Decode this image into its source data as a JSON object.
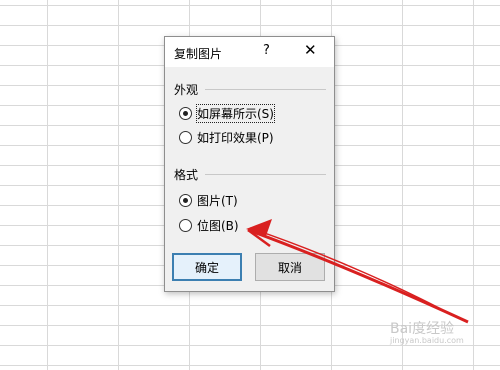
{
  "dialog": {
    "title": "复制图片",
    "help": "?",
    "close": "✕",
    "appearance": {
      "label": "外观",
      "options": [
        "如屏幕所示(S)",
        "如打印效果(P)"
      ],
      "selected": 0
    },
    "format": {
      "label": "格式",
      "options": [
        "图片(T)",
        "位图(B)"
      ],
      "selected": 0
    },
    "ok_label": "确定",
    "cancel_label": "取消"
  },
  "watermark": {
    "text": "Bai度经验",
    "sub": "jingyan.baidu.com"
  },
  "colors": {
    "arrow": "#d92020",
    "grid": "#d9d9d9"
  }
}
